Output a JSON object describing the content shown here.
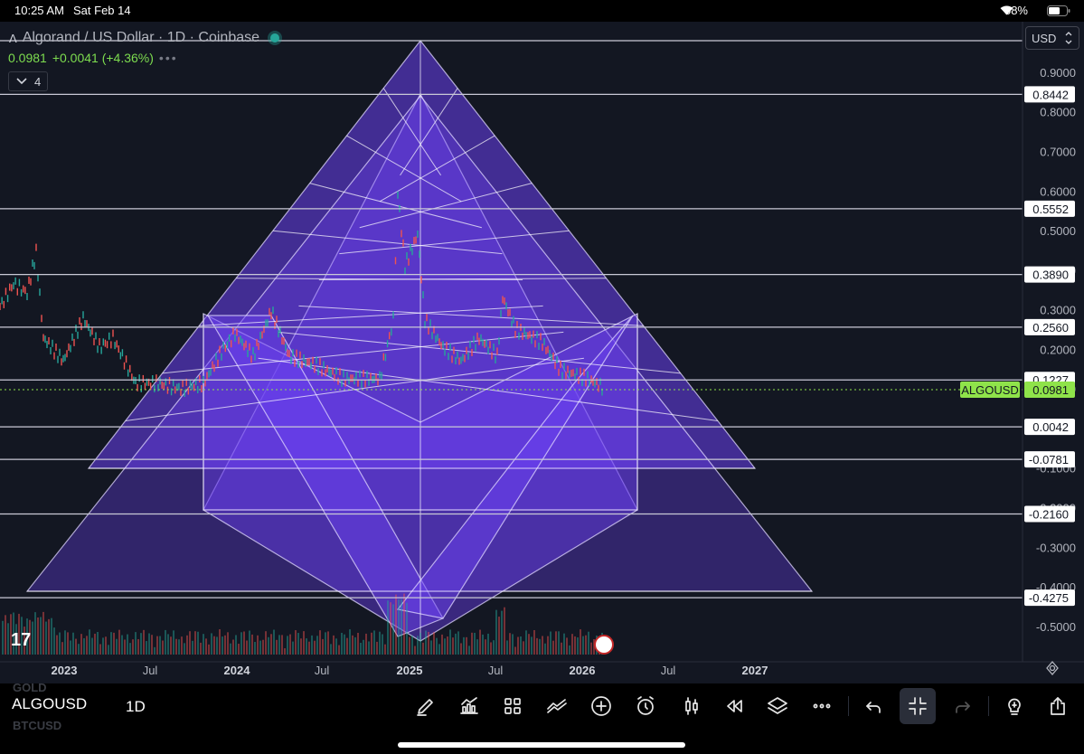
{
  "status_bar": {
    "time": "10:25 AM",
    "date": "Sat Feb 14",
    "battery": "58%"
  },
  "legend": {
    "title": "Algorand / US Dollar · 1D · Coinbase",
    "price": "0.0981",
    "change": "+0.0041 (+4.36%)",
    "more_dots": "•••",
    "indicator_count": "4"
  },
  "currency": {
    "selected": "USD"
  },
  "colors": {
    "background": "#131722",
    "pyramid_fill": "#6a3ff0",
    "price_label_bg": "#8fe34a",
    "gridline": "#c9c9d6",
    "candle_up": "#26a69a",
    "candle_down": "#ef5350"
  },
  "chart_data": {
    "type": "line",
    "symbol": "ALGOUSD",
    "interval": "1D",
    "current_price": 0.0981,
    "y_ticks": [
      "0.9000",
      "0.8000",
      "0.7000",
      "0.6000",
      "0.5000",
      "0.4000",
      "0.3000",
      "0.2000",
      "0.1000",
      "-0.1000",
      "-0.2000",
      "-0.3000",
      "-0.4000",
      "-0.5000"
    ],
    "levels": [
      "0.8442",
      "0.5552",
      "0.3890",
      "0.2560",
      "0.1227",
      "0.0042",
      "-0.0781",
      "-0.2160",
      "-0.4275"
    ],
    "x_ticks": [
      "2023",
      "Jul",
      "2024",
      "Jul",
      "2025",
      "Jul",
      "2026",
      "Jul",
      "2027"
    ],
    "price_label": "ALGOUSD"
  },
  "toolbar": {
    "symbol": "ALGOUSD",
    "ghost_above": "GOLD",
    "ghost_below": "BTCUSD",
    "interval": "1D",
    "icons": [
      "draw-icon",
      "indicators-icon",
      "layout-icon",
      "compare-icon",
      "add-icon",
      "alert-icon",
      "chart-type-icon",
      "replay-icon",
      "layers-icon",
      "more-icon",
      "undo-icon",
      "fullscreen-exit-icon",
      "redo-icon",
      "ideas-icon",
      "share-icon"
    ]
  }
}
